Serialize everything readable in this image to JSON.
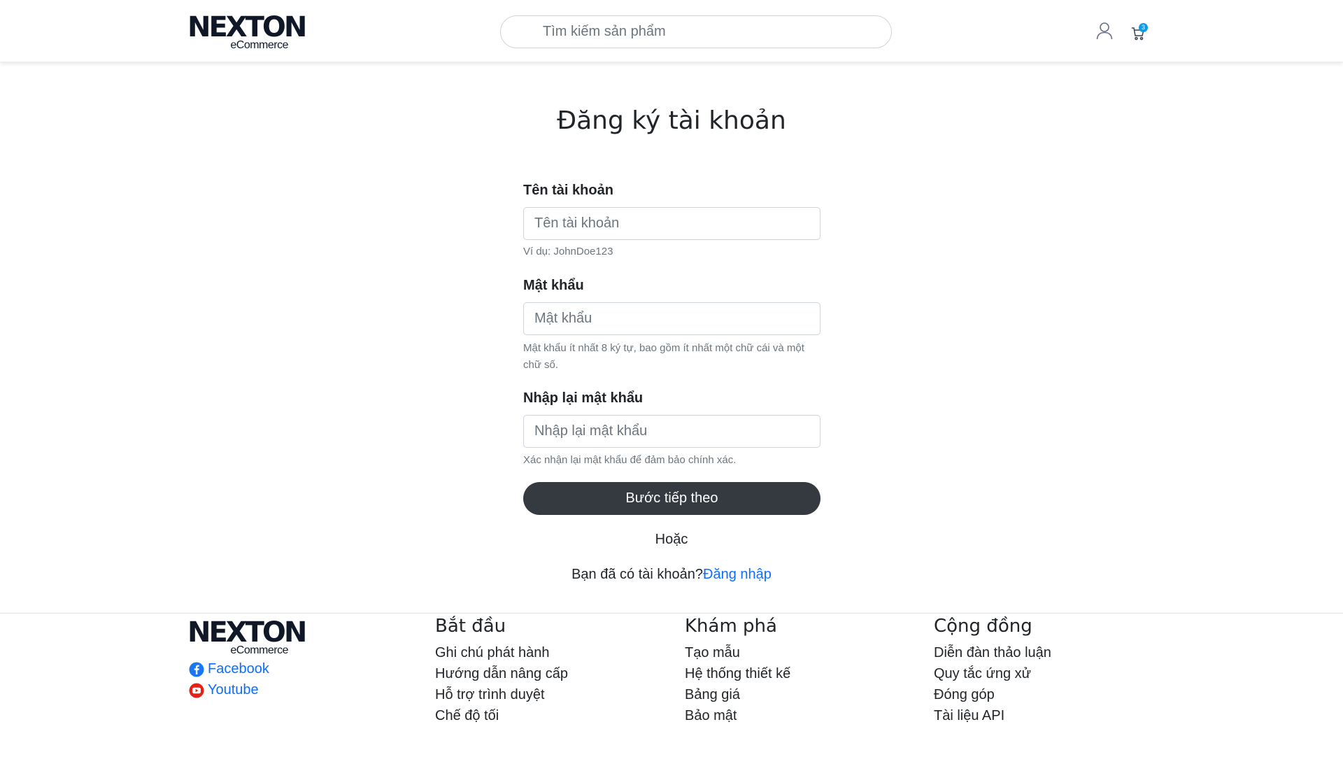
{
  "brand": {
    "name": "NEXTON",
    "tagline": "eCommerce"
  },
  "header": {
    "search_placeholder": "Tìm kiếm sản phẩm",
    "cart_count": "3"
  },
  "form": {
    "title": "Đăng ký tài khoản",
    "username": {
      "label": "Tên tài khoản",
      "placeholder": "Tên tài khoản",
      "hint": "Ví dụ: JohnDoe123"
    },
    "password": {
      "label": "Mật khẩu",
      "placeholder": "Mật khẩu",
      "hint": "Mật khẩu ít nhất 8 ký tự, bao gồm ít nhất một chữ cái và một chữ số."
    },
    "confirm": {
      "label": "Nhập lại mật khẩu",
      "placeholder": "Nhập lại mật khẩu",
      "hint": "Xác nhận lại mật khẩu để đảm bảo chính xác."
    },
    "submit_label": "Bước tiếp theo",
    "or_text": "Hoặc",
    "have_account_text": "Bạn đã có tài khoản?",
    "login_link": "Đăng nhập"
  },
  "footer": {
    "social": [
      {
        "label": "Facebook",
        "icon": "facebook-icon",
        "color": "#1877f2"
      },
      {
        "label": "Youtube",
        "icon": "youtube-icon",
        "color": "#e62117"
      }
    ],
    "columns": [
      {
        "title": "Bắt đầu",
        "links": [
          "Ghi chú phát hành",
          "Hướng dẫn nâng cấp",
          "Hỗ trợ trình duyệt",
          "Chế độ tối"
        ]
      },
      {
        "title": "Khám phá",
        "links": [
          "Tạo mẫu",
          "Hệ thống thiết kế",
          "Bảng giá",
          "Bảo mật"
        ]
      },
      {
        "title": "Cộng đồng",
        "links": [
          "Diễn đàn thảo luận",
          "Quy tắc ứng xử",
          "Đóng góp",
          "Tài liệu API"
        ]
      }
    ]
  }
}
